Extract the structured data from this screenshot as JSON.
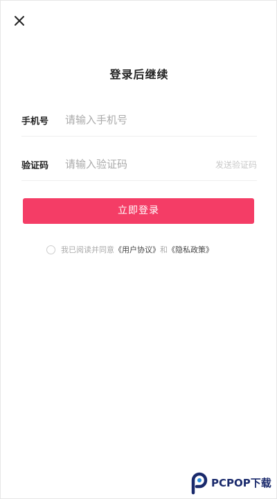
{
  "header": {
    "close_icon": "close-icon",
    "title": "登录后继续"
  },
  "form": {
    "phone": {
      "label": "手机号",
      "placeholder": "请输入手机号",
      "value": ""
    },
    "code": {
      "label": "验证码",
      "placeholder": "请输入验证码",
      "value": "",
      "send_label": "发送验证码"
    },
    "submit_label": "立即登录"
  },
  "agreement": {
    "checked": false,
    "prefix": "我已阅读并同意",
    "user_agreement": "《用户协议》",
    "conjunction": "和",
    "privacy_policy": "《隐私政策》"
  },
  "watermark": {
    "text": "PCPOP下载"
  },
  "colors": {
    "accent": "#f43d66",
    "placeholder": "#aaaaaa",
    "watermark_blue": "#1a2a6c"
  }
}
